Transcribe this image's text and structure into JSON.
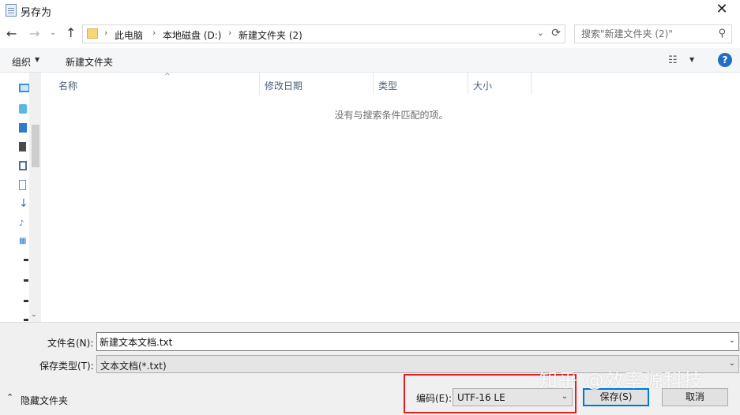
{
  "window": {
    "title": "另存为",
    "close_glyph": "✕"
  },
  "nav": {
    "back": "←",
    "forward": "→",
    "recent": "⌄",
    "up": "↑"
  },
  "address": {
    "crumbs": [
      "此电脑",
      "本地磁盘 (D:)",
      "新建文件夹 (2)"
    ],
    "separator": "›",
    "dropdown": "⌄",
    "refresh": "⟳"
  },
  "search": {
    "placeholder": "搜索\"新建文件夹 (2)\"",
    "icon": "⚲"
  },
  "toolbar": {
    "organize": "组织",
    "caret": "▼",
    "new_folder": "新建文件夹",
    "view_icon": "☷",
    "help": "?"
  },
  "columns": [
    "名称",
    "修改日期",
    "类型",
    "大小"
  ],
  "sort_arrow": "^",
  "empty_message": "没有与搜索条件匹配的项。",
  "nav_pane": {
    "scroll_down": "⌄"
  },
  "form": {
    "filename_label": "文件名(N):",
    "filename_value": "新建文本文档.txt",
    "filetype_label": "保存类型(T):",
    "filetype_value": "文本文档(*.txt)",
    "dropdown_caret": "⌄",
    "encoding_label": "编码(E):",
    "encoding_value": "UTF-16 LE",
    "hide_folders_label": "隐藏文件夹",
    "hide_caret": "⌃",
    "save_button": "保存(S)",
    "cancel_button": "取消"
  },
  "watermark": "知乎 @效率源科技",
  "colors": {
    "accent": "#0078d7",
    "highlight": "#e02020",
    "help": "#1f6fc5"
  }
}
